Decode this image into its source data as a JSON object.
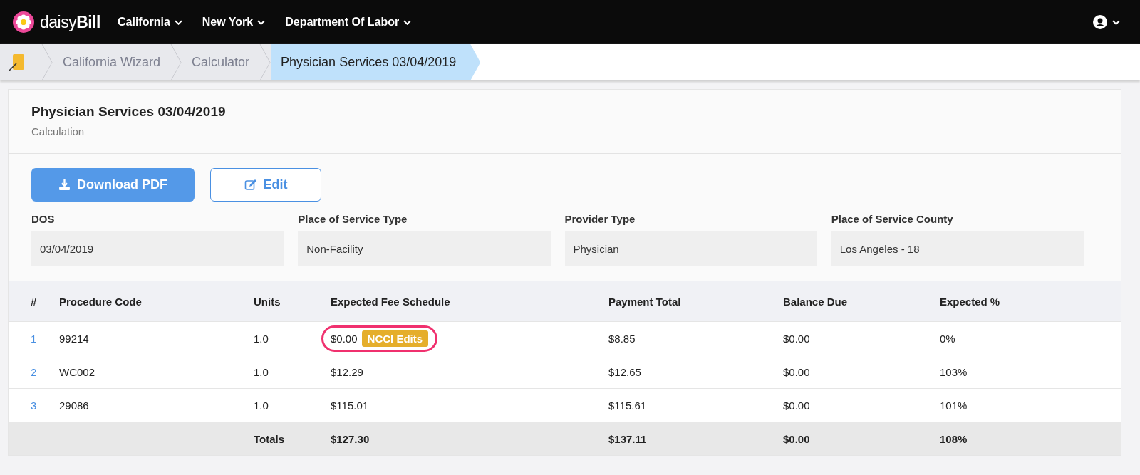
{
  "navbar": {
    "logo": {
      "prefix": "daisy",
      "suffix": "Bill"
    },
    "menus": [
      {
        "label": "California"
      },
      {
        "label": "New York"
      },
      {
        "label": "Department Of Labor"
      }
    ]
  },
  "breadcrumb": [
    {
      "label": "California Wizard",
      "selected": false
    },
    {
      "label": "Calculator",
      "selected": false
    },
    {
      "label": "Physician Services 03/04/2019",
      "selected": true
    }
  ],
  "page": {
    "title": "Physician Services 03/04/2019",
    "subtitle": "Calculation"
  },
  "buttons": [
    {
      "kind": "primary",
      "label": "Download PDF"
    },
    {
      "kind": "outline",
      "label": "Edit"
    }
  ],
  "fields": [
    {
      "label": "DOS",
      "value": "03/04/2019"
    },
    {
      "label": "Place of Service Type",
      "value": "Non-Facility"
    },
    {
      "label": "Provider Type",
      "value": "Physician"
    },
    {
      "label": "Place of Service County",
      "value": "Los Angeles - 18"
    }
  ],
  "table": {
    "columns": [
      "#",
      "Procedure Code",
      "Units",
      "Expected Fee Schedule",
      "Payment Total",
      "Balance Due",
      "Expected %"
    ],
    "rows": [
      {
        "number": "1",
        "code": "99214",
        "units": "1.0",
        "fee": "$0.00",
        "badge": "NCCI Edits",
        "highlighted": true,
        "payment": "$8.85",
        "balance": "$0.00",
        "expected": "0%"
      },
      {
        "number": "2",
        "code": "WC002",
        "units": "1.0",
        "fee": "$12.29",
        "highlighted": false,
        "payment": "$12.65",
        "balance": "$0.00",
        "expected": "103%"
      },
      {
        "number": "3",
        "code": "29086",
        "units": "1.0",
        "fee": "$115.01",
        "highlighted": false,
        "payment": "$115.61",
        "balance": "$0.00",
        "expected": "101%"
      }
    ],
    "totals": {
      "label": "Totals",
      "fee": "$127.30",
      "payment": "$137.11",
      "balance": "$0.00",
      "expected": "108%"
    }
  }
}
